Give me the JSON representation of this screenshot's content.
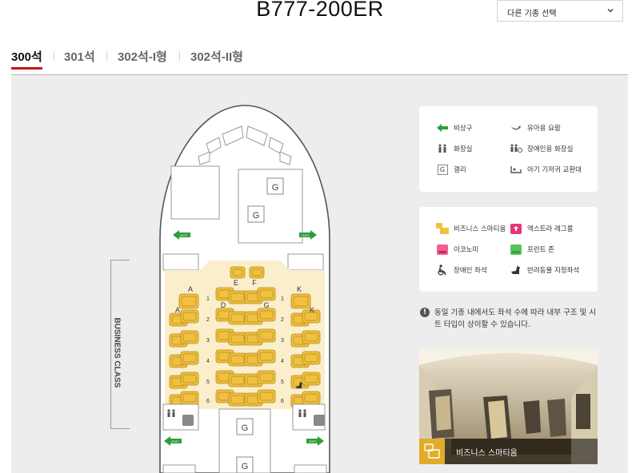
{
  "header": {
    "title": "B777-200ER",
    "type_select": {
      "selected": "다른 기종 선택"
    }
  },
  "tabs": [
    {
      "label": "300석",
      "active": true
    },
    {
      "label": "301석",
      "active": false
    },
    {
      "label": "302석-I형",
      "active": false
    },
    {
      "label": "302석-II형",
      "active": false
    }
  ],
  "seatmap": {
    "section_label": "BUSINESS CLASS",
    "galley": "G",
    "exit_label": "EXIT",
    "column_letters": [
      "A",
      "E",
      "F",
      "K",
      "A",
      "D",
      "G",
      "K"
    ],
    "row_numbers": [
      "1",
      "2",
      "3",
      "4",
      "5",
      "6"
    ]
  },
  "legend_facilities": [
    {
      "icon": "exit-arrow-icon",
      "label": "비상구"
    },
    {
      "icon": "bassinet-icon",
      "label": "유아용 요람"
    },
    {
      "icon": "lavatory-icon",
      "label": "화장실"
    },
    {
      "icon": "accessible-lavatory-icon",
      "label": "장애인용 화장실"
    },
    {
      "icon": "galley-icon",
      "label": "갤리",
      "glyph": "G"
    },
    {
      "icon": "diaper-table-icon",
      "label": "아기 기저귀 교환대"
    }
  ],
  "legend_seats": [
    {
      "icon": "business-smartium-icon",
      "label": "비즈니스 스마티움",
      "color": "#f0c040"
    },
    {
      "icon": "extra-legroom-icon",
      "label": "엑스트라 레그룸",
      "color": "#e8357a"
    },
    {
      "icon": "economy-icon",
      "label": "이코노미",
      "color": "#f06090"
    },
    {
      "icon": "front-zone-icon",
      "label": "프런트 존",
      "color": "#59c25c"
    },
    {
      "icon": "disabled-seat-icon",
      "label": "장애인 좌석"
    },
    {
      "icon": "pet-seat-icon",
      "label": "반려동물 지정좌석"
    }
  ],
  "notice": "동일 기종 내에서도 좌석 수에 따라 내부 구조 및 시트 타입이 상이할 수 있습니다.",
  "photo": {
    "caption": "비즈니스 스마티움"
  },
  "colors": {
    "accent": "#c3161c",
    "seat_yellow": "#f0c040",
    "exit_green": "#2e9e3a"
  }
}
